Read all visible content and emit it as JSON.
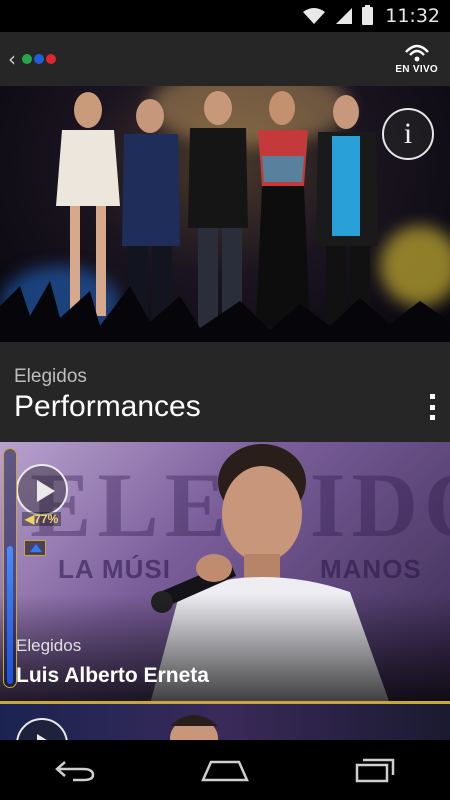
{
  "status_bar": {
    "time": "11:32",
    "icons": [
      "wifi-icon",
      "signal-icon",
      "battery-icon"
    ]
  },
  "app_bar": {
    "back_icon": "back-chevron-icon",
    "logo_colors": [
      "#2aa64a",
      "#1f5fd6",
      "#e0262b"
    ],
    "live_label": "EN VIVO",
    "live_icon": "broadcast-icon"
  },
  "hero": {
    "info_label": "i"
  },
  "section": {
    "subtitle": "Elegidos",
    "title": "Performances",
    "menu_icon": "overflow-menu-icon"
  },
  "cards": [
    {
      "background_title": "ELEGIDO",
      "background_subtitle_left": "LA MÚSI",
      "background_subtitle_right": "MANOS",
      "category": "Elegidos",
      "name": "Luis Alberto Erneta",
      "score_badge": "◀77%",
      "slider_fill": 0.58
    }
  ],
  "nav": {
    "back": "back-icon",
    "home": "home-icon",
    "recents": "recents-icon"
  },
  "colors": {
    "accent_gold": "#c9a53a",
    "panel": "#262626",
    "slider_blue": "#1b52d8"
  }
}
